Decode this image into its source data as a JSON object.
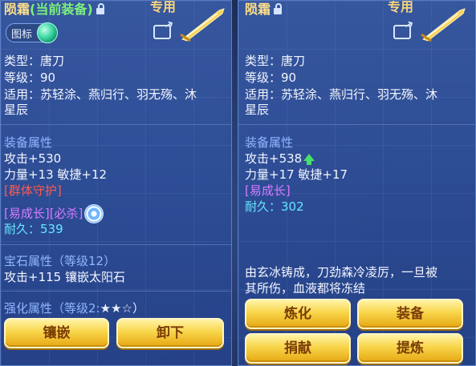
{
  "left": {
    "title": "陨霜",
    "title_current": "(当前装备)",
    "zhuanyong": "专用",
    "icon_badge_label": "图标",
    "type_line": "类型：唐刀",
    "level_line": "等级：90",
    "fit_line1": "适用：苏轻涂、燕归行、羽无殇、沐",
    "fit_line2": "星辰",
    "equip_attr_title": "装备属性",
    "attack": "攻击+530",
    "stats": "力量+13 敏捷+12",
    "skill1": "[群体守护]",
    "skill2": "[易成长][必杀]",
    "durability": "耐久：539",
    "gem_title": "宝石属性（等级12）",
    "gem_line": "攻击+115 镶嵌太阳石",
    "enhance_title": "强化属性（等级2:",
    "enhance_stars": "★★☆）",
    "buttons": [
      "镶嵌",
      "卸下"
    ]
  },
  "right": {
    "title": "陨霜",
    "zhuanyong": "专用",
    "type_line": "类型：唐刀",
    "level_line": "等级：90",
    "fit_line1": "适用：苏轻涂、燕归行、羽无殇、沐",
    "fit_line2": "星辰",
    "equip_attr_title": "装备属性",
    "attack": "攻击+538",
    "stats": "力量+17 敏捷+17",
    "skill1": "[易成长]",
    "durability": "耐久：302",
    "desc_line1": "由玄冰铸成，刀劲森冷凌厉，一旦被",
    "desc_line2": "其所伤，血液都将冻结",
    "buttons": [
      "炼化",
      "装备",
      "捐献",
      "提炼"
    ]
  },
  "colors": {
    "title_gold": "#ffdf8a",
    "current_green": "#7cf07c",
    "section_blue": "#8fb6ff",
    "skill_red": "#ff5a4e",
    "skill_pink": "#d77bff",
    "durability_cyan": "#66e6ff",
    "button_gold": "#f8d54a"
  },
  "icons": [
    "lock-icon",
    "share-icon",
    "sword-icon",
    "green-orb-icon",
    "swirl-icon",
    "arrow-up-icon"
  ]
}
